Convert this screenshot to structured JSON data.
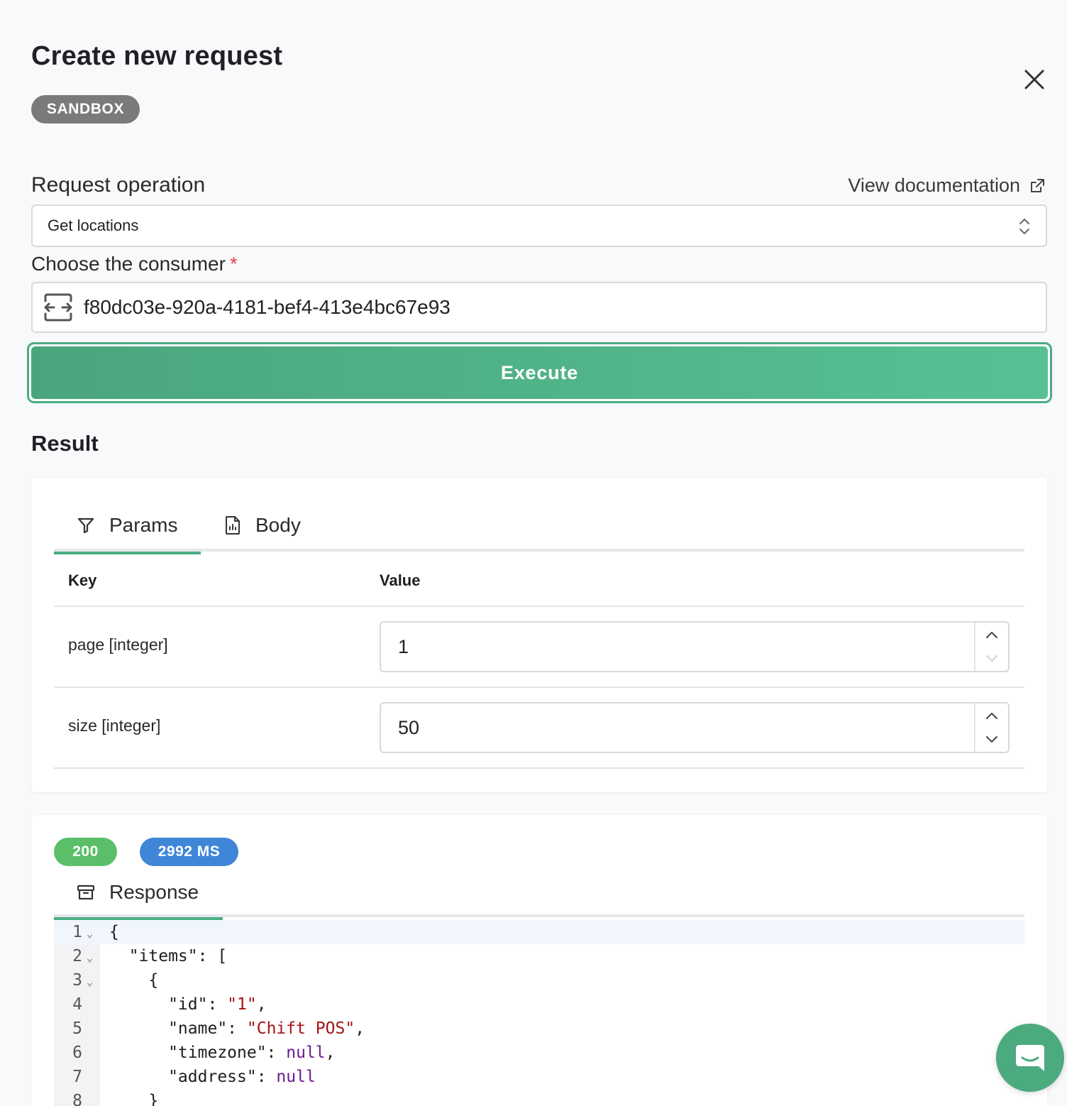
{
  "modal": {
    "title": "Create new request",
    "environment_badge": "SANDBOX",
    "close_icon": "close-icon"
  },
  "operation": {
    "label": "Request operation",
    "doc_link": "View documentation",
    "selected": "Get locations"
  },
  "consumer": {
    "label": "Choose the consumer",
    "required_mark": "*",
    "value": "f80dc03e-920a-4181-bef4-413e4bc67e93",
    "icon": "swap-arrows-icon"
  },
  "execute": {
    "label": "Execute"
  },
  "result": {
    "title": "Result",
    "tabs": [
      {
        "label": "Params",
        "icon": "filter-icon",
        "active": true
      },
      {
        "label": "Body",
        "icon": "document-icon",
        "active": false
      }
    ],
    "table": {
      "headers": {
        "key": "Key",
        "value": "Value"
      },
      "rows": [
        {
          "key": "page [integer]",
          "value": "1"
        },
        {
          "key": "size [integer]",
          "value": "50"
        }
      ]
    }
  },
  "response": {
    "status": "200",
    "duration": "2992 MS",
    "tab_label": "Response",
    "tab_icon": "archive-box-icon",
    "lines": [
      {
        "n": "1",
        "fold": true,
        "text": "{"
      },
      {
        "n": "2",
        "fold": true,
        "text": "  \"items\": ["
      },
      {
        "n": "3",
        "fold": true,
        "text": "    {"
      },
      {
        "n": "4",
        "fold": false,
        "text": "      \"id\": \"1\","
      },
      {
        "n": "5",
        "fold": false,
        "text": "      \"name\": \"Chift POS\","
      },
      {
        "n": "6",
        "fold": false,
        "text": "      \"timezone\": null,"
      },
      {
        "n": "7",
        "fold": false,
        "text": "      \"address\": null"
      },
      {
        "n": "8",
        "fold": false,
        "text": "    }"
      }
    ]
  },
  "colors": {
    "accent": "#4aad82",
    "status_success": "#5bbf6a",
    "duration_badge": "#3f86d8",
    "sandbox_badge": "#7a7a7a"
  },
  "chat_widget": {
    "icon": "chat-bubble-icon"
  }
}
